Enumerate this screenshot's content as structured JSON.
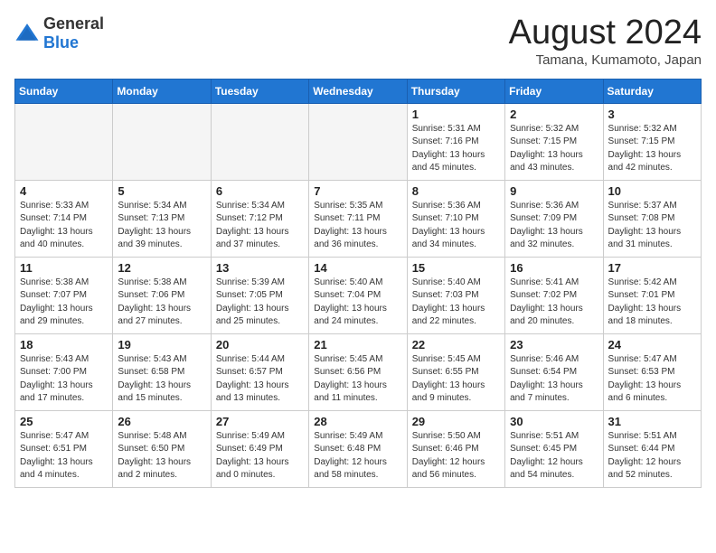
{
  "logo": {
    "general": "General",
    "blue": "Blue"
  },
  "header": {
    "month_year": "August 2024",
    "location": "Tamana, Kumamoto, Japan"
  },
  "weekdays": [
    "Sunday",
    "Monday",
    "Tuesday",
    "Wednesday",
    "Thursday",
    "Friday",
    "Saturday"
  ],
  "weeks": [
    [
      {
        "day": "",
        "empty": true
      },
      {
        "day": "",
        "empty": true
      },
      {
        "day": "",
        "empty": true
      },
      {
        "day": "",
        "empty": true
      },
      {
        "day": "1",
        "sunrise": "5:31 AM",
        "sunset": "7:16 PM",
        "daylight": "13 hours and 45 minutes."
      },
      {
        "day": "2",
        "sunrise": "5:32 AM",
        "sunset": "7:15 PM",
        "daylight": "13 hours and 43 minutes."
      },
      {
        "day": "3",
        "sunrise": "5:32 AM",
        "sunset": "7:15 PM",
        "daylight": "13 hours and 42 minutes."
      }
    ],
    [
      {
        "day": "4",
        "sunrise": "5:33 AM",
        "sunset": "7:14 PM",
        "daylight": "13 hours and 40 minutes."
      },
      {
        "day": "5",
        "sunrise": "5:34 AM",
        "sunset": "7:13 PM",
        "daylight": "13 hours and 39 minutes."
      },
      {
        "day": "6",
        "sunrise": "5:34 AM",
        "sunset": "7:12 PM",
        "daylight": "13 hours and 37 minutes."
      },
      {
        "day": "7",
        "sunrise": "5:35 AM",
        "sunset": "7:11 PM",
        "daylight": "13 hours and 36 minutes."
      },
      {
        "day": "8",
        "sunrise": "5:36 AM",
        "sunset": "7:10 PM",
        "daylight": "13 hours and 34 minutes."
      },
      {
        "day": "9",
        "sunrise": "5:36 AM",
        "sunset": "7:09 PM",
        "daylight": "13 hours and 32 minutes."
      },
      {
        "day": "10",
        "sunrise": "5:37 AM",
        "sunset": "7:08 PM",
        "daylight": "13 hours and 31 minutes."
      }
    ],
    [
      {
        "day": "11",
        "sunrise": "5:38 AM",
        "sunset": "7:07 PM",
        "daylight": "13 hours and 29 minutes."
      },
      {
        "day": "12",
        "sunrise": "5:38 AM",
        "sunset": "7:06 PM",
        "daylight": "13 hours and 27 minutes."
      },
      {
        "day": "13",
        "sunrise": "5:39 AM",
        "sunset": "7:05 PM",
        "daylight": "13 hours and 25 minutes."
      },
      {
        "day": "14",
        "sunrise": "5:40 AM",
        "sunset": "7:04 PM",
        "daylight": "13 hours and 24 minutes."
      },
      {
        "day": "15",
        "sunrise": "5:40 AM",
        "sunset": "7:03 PM",
        "daylight": "13 hours and 22 minutes."
      },
      {
        "day": "16",
        "sunrise": "5:41 AM",
        "sunset": "7:02 PM",
        "daylight": "13 hours and 20 minutes."
      },
      {
        "day": "17",
        "sunrise": "5:42 AM",
        "sunset": "7:01 PM",
        "daylight": "13 hours and 18 minutes."
      }
    ],
    [
      {
        "day": "18",
        "sunrise": "5:43 AM",
        "sunset": "7:00 PM",
        "daylight": "13 hours and 17 minutes."
      },
      {
        "day": "19",
        "sunrise": "5:43 AM",
        "sunset": "6:58 PM",
        "daylight": "13 hours and 15 minutes."
      },
      {
        "day": "20",
        "sunrise": "5:44 AM",
        "sunset": "6:57 PM",
        "daylight": "13 hours and 13 minutes."
      },
      {
        "day": "21",
        "sunrise": "5:45 AM",
        "sunset": "6:56 PM",
        "daylight": "13 hours and 11 minutes."
      },
      {
        "day": "22",
        "sunrise": "5:45 AM",
        "sunset": "6:55 PM",
        "daylight": "13 hours and 9 minutes."
      },
      {
        "day": "23",
        "sunrise": "5:46 AM",
        "sunset": "6:54 PM",
        "daylight": "13 hours and 7 minutes."
      },
      {
        "day": "24",
        "sunrise": "5:47 AM",
        "sunset": "6:53 PM",
        "daylight": "13 hours and 6 minutes."
      }
    ],
    [
      {
        "day": "25",
        "sunrise": "5:47 AM",
        "sunset": "6:51 PM",
        "daylight": "13 hours and 4 minutes."
      },
      {
        "day": "26",
        "sunrise": "5:48 AM",
        "sunset": "6:50 PM",
        "daylight": "13 hours and 2 minutes."
      },
      {
        "day": "27",
        "sunrise": "5:49 AM",
        "sunset": "6:49 PM",
        "daylight": "13 hours and 0 minutes."
      },
      {
        "day": "28",
        "sunrise": "5:49 AM",
        "sunset": "6:48 PM",
        "daylight": "12 hours and 58 minutes."
      },
      {
        "day": "29",
        "sunrise": "5:50 AM",
        "sunset": "6:46 PM",
        "daylight": "12 hours and 56 minutes."
      },
      {
        "day": "30",
        "sunrise": "5:51 AM",
        "sunset": "6:45 PM",
        "daylight": "12 hours and 54 minutes."
      },
      {
        "day": "31",
        "sunrise": "5:51 AM",
        "sunset": "6:44 PM",
        "daylight": "12 hours and 52 minutes."
      }
    ]
  ],
  "labels": {
    "sunrise": "Sunrise:",
    "sunset": "Sunset:",
    "daylight": "Daylight:"
  }
}
